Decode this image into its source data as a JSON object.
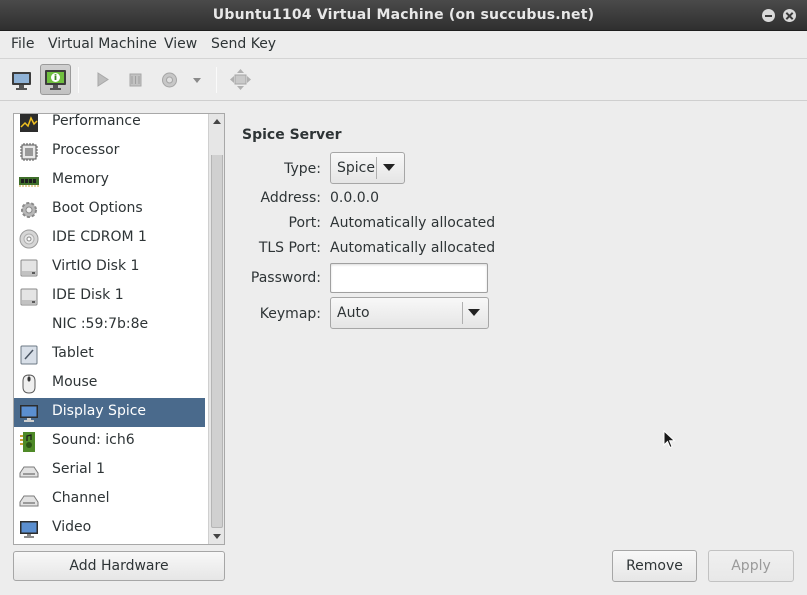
{
  "window": {
    "title": "Ubuntu1104 Virtual Machine (on succubus.net)"
  },
  "menubar": [
    "File",
    "Virtual Machine",
    "View",
    "Send Key"
  ],
  "toolbar": {
    "buttons": [
      "console-view",
      "details-view",
      "run",
      "pause",
      "shutdown",
      "shutdown-menu",
      "fullscreen"
    ],
    "active": "details-view"
  },
  "hardware_list": {
    "items": [
      {
        "label": "Performance",
        "icon": "performance-icon"
      },
      {
        "label": "Processor",
        "icon": "processor-icon"
      },
      {
        "label": "Memory",
        "icon": "memory-icon"
      },
      {
        "label": "Boot Options",
        "icon": "boot-options-icon"
      },
      {
        "label": "IDE CDROM 1",
        "icon": "cdrom-icon"
      },
      {
        "label": "VirtIO Disk 1",
        "icon": "disk-icon"
      },
      {
        "label": "IDE Disk 1",
        "icon": "disk-icon"
      },
      {
        "label": "NIC :59:7b:8e",
        "icon": "nic-icon"
      },
      {
        "label": "Tablet",
        "icon": "tablet-icon"
      },
      {
        "label": "Mouse",
        "icon": "mouse-icon"
      },
      {
        "label": "Display Spice",
        "icon": "display-icon"
      },
      {
        "label": "Sound: ich6",
        "icon": "sound-icon"
      },
      {
        "label": "Serial 1",
        "icon": "serial-icon"
      },
      {
        "label": "Channel",
        "icon": "channel-icon"
      },
      {
        "label": "Video",
        "icon": "video-icon"
      }
    ],
    "selected": "Display Spice"
  },
  "buttons": {
    "add_hardware": "Add Hardware",
    "remove": "Remove",
    "apply": "Apply"
  },
  "details": {
    "section_title": "Spice Server",
    "type": {
      "label": "Type:",
      "value": "Spice"
    },
    "address": {
      "label": "Address:",
      "value": "0.0.0.0"
    },
    "port": {
      "label": "Port:",
      "value": "Automatically allocated"
    },
    "tls_port": {
      "label": "TLS Port:",
      "value": "Automatically allocated"
    },
    "password": {
      "label": "Password:",
      "value": ""
    },
    "keymap": {
      "label": "Keymap:",
      "value": "Auto"
    }
  },
  "colors": {
    "selection": "#4a6a8c",
    "titlebar": "#3a3a3a",
    "background": "#ededed"
  }
}
